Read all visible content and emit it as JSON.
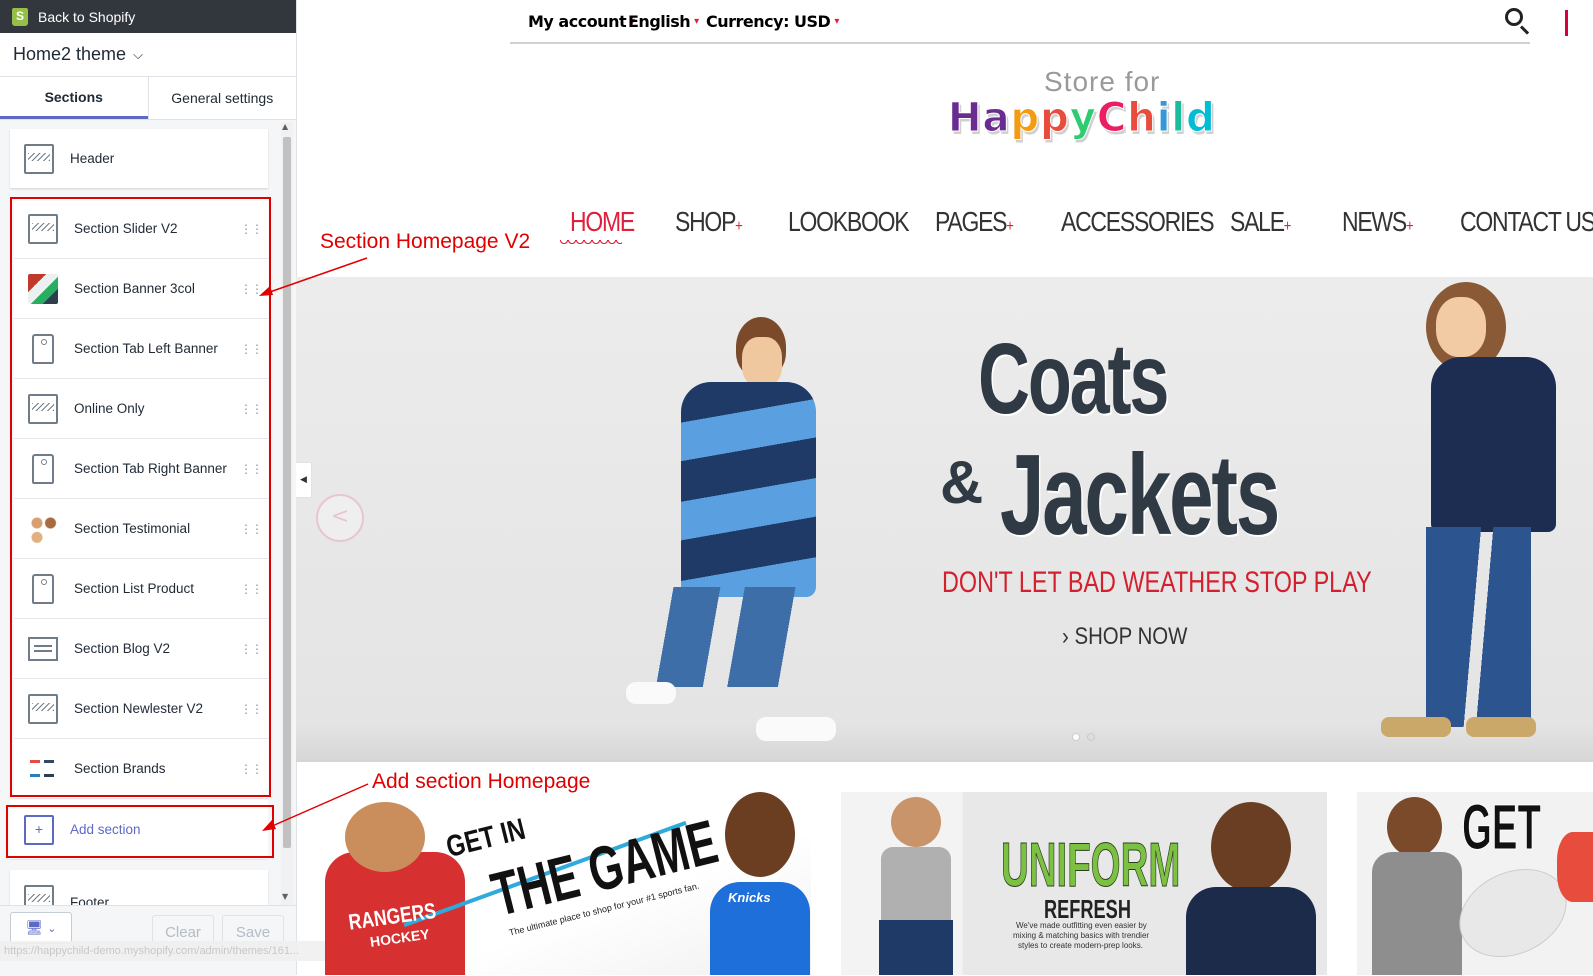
{
  "editor": {
    "back_label": "Back to Shopify",
    "theme_name": "Home2 theme",
    "tabs": [
      {
        "label": "Sections",
        "active": true
      },
      {
        "label": "General settings",
        "active": false
      }
    ],
    "header_label": "Header",
    "sections": [
      {
        "label": "Section Slider V2",
        "icon": "layout-icon"
      },
      {
        "label": "Section Banner 3col",
        "icon": "banner-thumbnail-icon"
      },
      {
        "label": "Section Tab Left Banner",
        "icon": "tag-icon"
      },
      {
        "label": "Online Only",
        "icon": "layout-icon"
      },
      {
        "label": "Section Tab Right Banner",
        "icon": "tag-icon"
      },
      {
        "label": "Section Testimonial",
        "icon": "avatars-icon"
      },
      {
        "label": "Section List Product",
        "icon": "tag-icon"
      },
      {
        "label": "Section Blog V2",
        "icon": "chat-icon"
      },
      {
        "label": "Section Newlester V2",
        "icon": "layout-icon"
      },
      {
        "label": "Section Brands",
        "icon": "brand-logos-icon"
      }
    ],
    "add_section_label": "Add section",
    "footer_label": "Footer",
    "clear_label": "Clear",
    "save_label": "Save",
    "status_url": "https://happychild-demo.myshopify.com/admin/themes/161..."
  },
  "annotations": {
    "homepage_sections": "Section Homepage V2",
    "add_section": "Add section Homepage",
    "color": "#e00000"
  },
  "store": {
    "utility": {
      "account": "My account",
      "language": "English",
      "currency": "Currency: USD"
    },
    "logo_top": "Store for",
    "logo_letters": [
      {
        "ch": "H",
        "color": "#6a2c91"
      },
      {
        "ch": "a",
        "color": "#6a2c91"
      },
      {
        "ch": "p",
        "color": "#f39c12"
      },
      {
        "ch": "p",
        "color": "#e74c3c"
      },
      {
        "ch": "y",
        "color": "#2ecc71"
      },
      {
        "ch": "C",
        "color": "#e91e63"
      },
      {
        "ch": "h",
        "color": "#e74c3c"
      },
      {
        "ch": "i",
        "color": "#3498db"
      },
      {
        "ch": "l",
        "color": "#1abc9c"
      },
      {
        "ch": "d",
        "color": "#00bcd4"
      }
    ],
    "nav": [
      {
        "label": "HOME",
        "plus": false,
        "active": true
      },
      {
        "label": "SHOP",
        "plus": true
      },
      {
        "label": "LOOKBOOK",
        "plus": false
      },
      {
        "label": "PAGES",
        "plus": true
      },
      {
        "label": "ACCESSORIES",
        "plus": false
      },
      {
        "label": "SALE",
        "plus": true
      },
      {
        "label": "NEWS",
        "plus": true
      },
      {
        "label": "CONTACT US",
        "plus": false
      }
    ],
    "plus_sign": "+",
    "hero": {
      "line1": "Coats",
      "amp": "&",
      "line2": "Jackets",
      "tagline": "DON'T LET BAD WEATHER STOP PLAY",
      "cta": "› SHOP NOW",
      "prev_arrow": "<"
    },
    "banners": {
      "game_top": "GET IN",
      "game_big": "THE GAME",
      "game_small": "The ultimate place to shop for your #1 sports fan.",
      "game_shirt": "RANGERS",
      "game_shirt2": "HOCKEY",
      "game_shirt3": "Knicks",
      "uniform_big": "UNIFORM",
      "uniform_sub": "REFRESH",
      "uniform_small1": "We've made outfitting even easier by",
      "uniform_small2": "mixing & matching basics with trendier",
      "uniform_small3": "styles to create modern-prep looks.",
      "get_big": "GET"
    },
    "accent": "#e0203a"
  }
}
